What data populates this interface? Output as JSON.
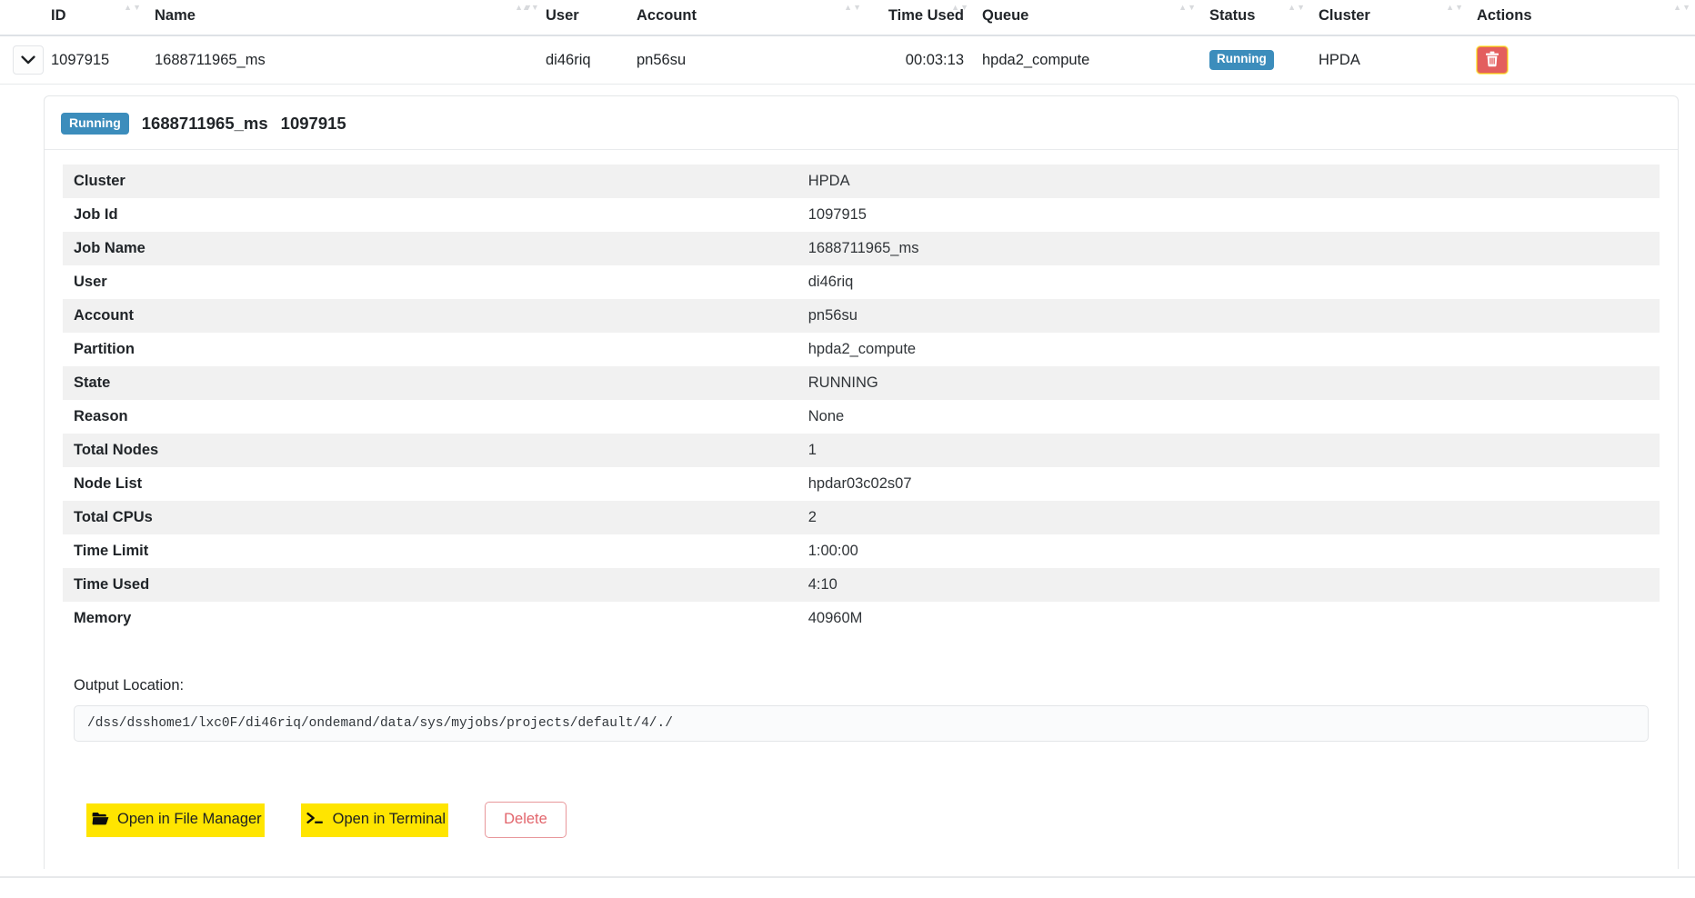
{
  "jobs_table": {
    "columns": [
      {
        "key": "id",
        "label": "ID",
        "align": "left"
      },
      {
        "key": "name",
        "label": "Name",
        "align": "left"
      },
      {
        "key": "user",
        "label": "User",
        "align": "left"
      },
      {
        "key": "account",
        "label": "Account",
        "align": "left"
      },
      {
        "key": "time_used",
        "label": "Time Used",
        "align": "right"
      },
      {
        "key": "queue",
        "label": "Queue",
        "align": "left"
      },
      {
        "key": "status",
        "label": "Status",
        "align": "left"
      },
      {
        "key": "cluster",
        "label": "Cluster",
        "align": "left"
      },
      {
        "key": "actions",
        "label": "Actions",
        "align": "left"
      }
    ],
    "sort_indicator": "▲▼",
    "row": {
      "id": "1097915",
      "name": "1688711965_ms",
      "user": "di46riq",
      "account": "pn56su",
      "time_used": "00:03:13",
      "queue": "hpda2_compute",
      "status": "Running",
      "cluster": "HPDA",
      "delete_icon": "trash-icon",
      "expander_icon": "chevron-down-icon"
    }
  },
  "detail": {
    "status_badge": "Running",
    "job_name": "1688711965_ms",
    "job_id": "1097915",
    "rows": [
      {
        "key": "Cluster",
        "value": "HPDA"
      },
      {
        "key": "Job Id",
        "value": "1097915"
      },
      {
        "key": "Job Name",
        "value": "1688711965_ms"
      },
      {
        "key": "User",
        "value": "di46riq"
      },
      {
        "key": "Account",
        "value": "pn56su"
      },
      {
        "key": "Partition",
        "value": "hpda2_compute"
      },
      {
        "key": "State",
        "value": "RUNNING"
      },
      {
        "key": "Reason",
        "value": "None"
      },
      {
        "key": "Total Nodes",
        "value": "1"
      },
      {
        "key": "Node List",
        "value": "hpdar03c02s07"
      },
      {
        "key": "Total CPUs",
        "value": "2"
      },
      {
        "key": "Time Limit",
        "value": "1:00:00"
      },
      {
        "key": "Time Used",
        "value": "4:10"
      },
      {
        "key": "Memory",
        "value": "40960M"
      }
    ],
    "output_label": "Output Location:",
    "output_path": "/dss/dsshome1/lxc0F/di46riq/ondemand/data/sys/myjobs/projects/default/4/./",
    "buttons": {
      "file_manager": {
        "label": "Open in File Manager",
        "icon": "folder-open-icon"
      },
      "terminal": {
        "label": "Open in Terminal",
        "icon": "terminal-icon"
      },
      "delete": {
        "label": "Delete"
      }
    }
  },
  "colors": {
    "badge_blue": "#3c8dbc",
    "danger_red": "#e35e5e",
    "highlight_yellow": "#ffe500",
    "stripe_gray": "#f1f1f1"
  }
}
